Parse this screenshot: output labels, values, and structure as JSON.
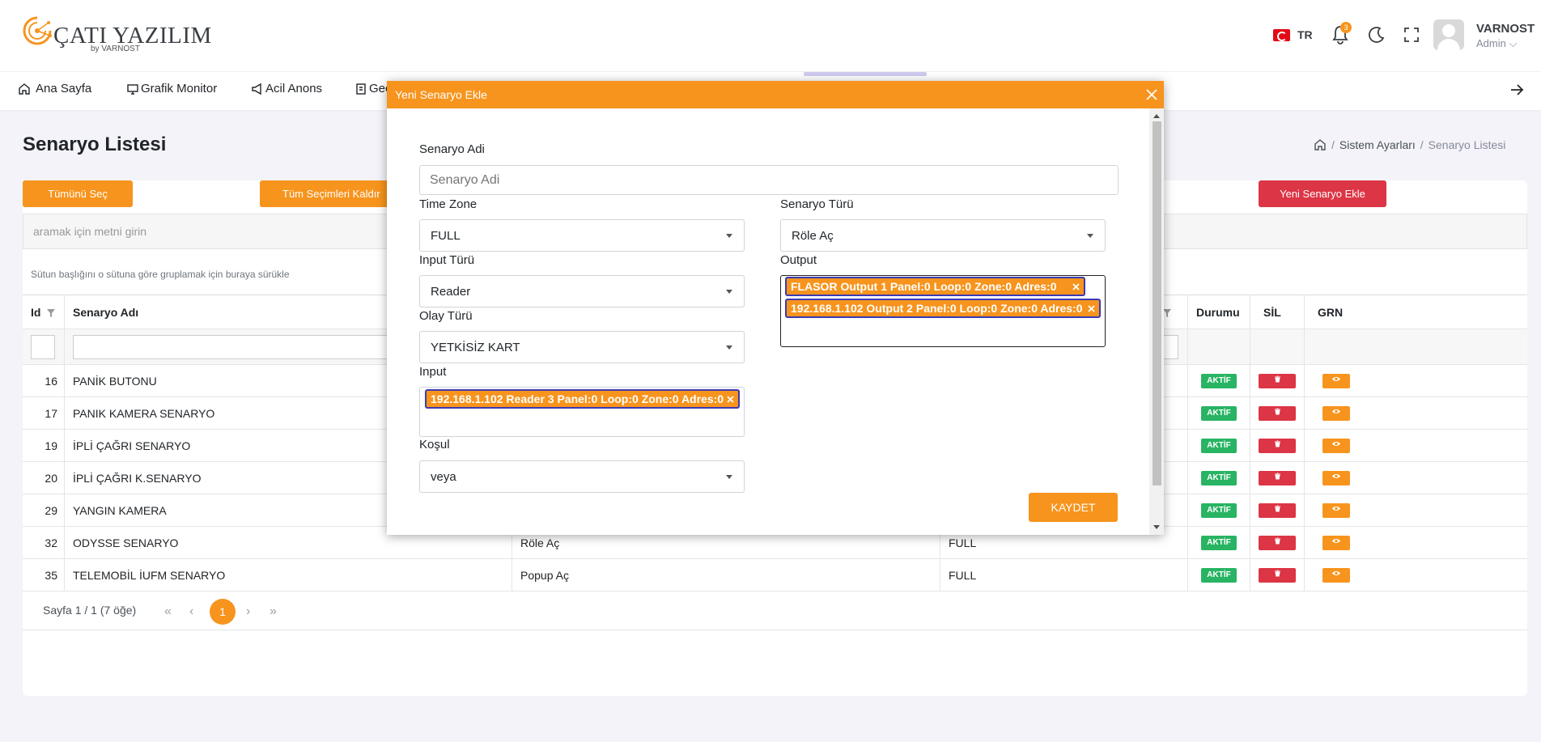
{
  "brand": {
    "name": "ÇATI YAZILIM",
    "sub": "by VARNOST"
  },
  "header": {
    "lang": "TR",
    "notif_count": "3",
    "user_name": "VARNOST",
    "user_role": "Admin ⌵"
  },
  "nav": {
    "items": [
      "Ana Sayfa",
      "Grafik Monitor",
      "Acil Anons",
      "Geç"
    ]
  },
  "page": {
    "title": "Senaryo Listesi",
    "breadcrumb": [
      "Sistem Ayarları",
      "Senaryo Listesi"
    ]
  },
  "toolbar": {
    "select_all": "Tümünü Seç",
    "clear_all": "Tüm Seçimleri Kaldır",
    "add_new": "Yeni Senaryo Ekle"
  },
  "search": {
    "placeholder": "aramak için metni girin"
  },
  "grid": {
    "group_hint": "Sütun başlığını o sütuna göre gruplamak için buraya sürükle",
    "headers": {
      "id": "Id",
      "name": "Senaryo Adı",
      "status": "Durumu",
      "delete": "SİL",
      "view": "GRN"
    },
    "rows": [
      {
        "id": "16",
        "name": "PANİK BUTONU",
        "type": "",
        "zone": "",
        "status": "AKTİF"
      },
      {
        "id": "17",
        "name": "PANIK KAMERA SENARYO",
        "type": "",
        "zone": "",
        "status": "AKTİF"
      },
      {
        "id": "19",
        "name": "İPLİ ÇAĞRI SENARYO",
        "type": "",
        "zone": "",
        "status": "AKTİF"
      },
      {
        "id": "20",
        "name": "İPLİ ÇAĞRI K.SENARYO",
        "type": "",
        "zone": "",
        "status": "AKTİF"
      },
      {
        "id": "29",
        "name": "YANGIN KAMERA",
        "type": "",
        "zone": "",
        "status": "AKTİF"
      },
      {
        "id": "32",
        "name": "ODYSSE SENARYO",
        "type": "Röle Aç",
        "zone": "FULL",
        "status": "AKTİF"
      },
      {
        "id": "35",
        "name": "TELEMOBİL İUFM SENARYO",
        "type": "Popup Aç",
        "zone": "FULL",
        "status": "AKTİF"
      }
    ]
  },
  "pager": {
    "text": "Sayfa 1 / 1 (7 öğe)",
    "current": "1"
  },
  "modal": {
    "title": "Yeni Senaryo Ekle",
    "name_label": "Senaryo Adi",
    "name_placeholder": "Senaryo Adi",
    "timezone_label": "Time Zone",
    "timezone_value": "FULL",
    "type_label": "Senaryo Türü",
    "type_value": "Röle Aç",
    "input_type_label": "Input Türü",
    "input_type_value": "Reader",
    "output_label": "Output",
    "outputs": [
      "FLASOR Output 1 Panel:0 Loop:0 Zone:0 Adres:0",
      "192.168.1.102 Output 2 Panel:0 Loop:0 Zone:0 Adres:0"
    ],
    "event_label": "Olay Türü",
    "event_value": "YETKİSİZ KART",
    "input_label": "Input",
    "inputs": [
      "192.168.1.102 Reader 3 Panel:0 Loop:0 Zone:0 Adres:0"
    ],
    "condition_label": "Koşul",
    "condition_value": "veya",
    "save": "KAYDET"
  },
  "colors": {
    "accent": "#f7941d",
    "danger": "#dc3545",
    "success": "#28b463",
    "tag_border": "#3b3bb3"
  }
}
